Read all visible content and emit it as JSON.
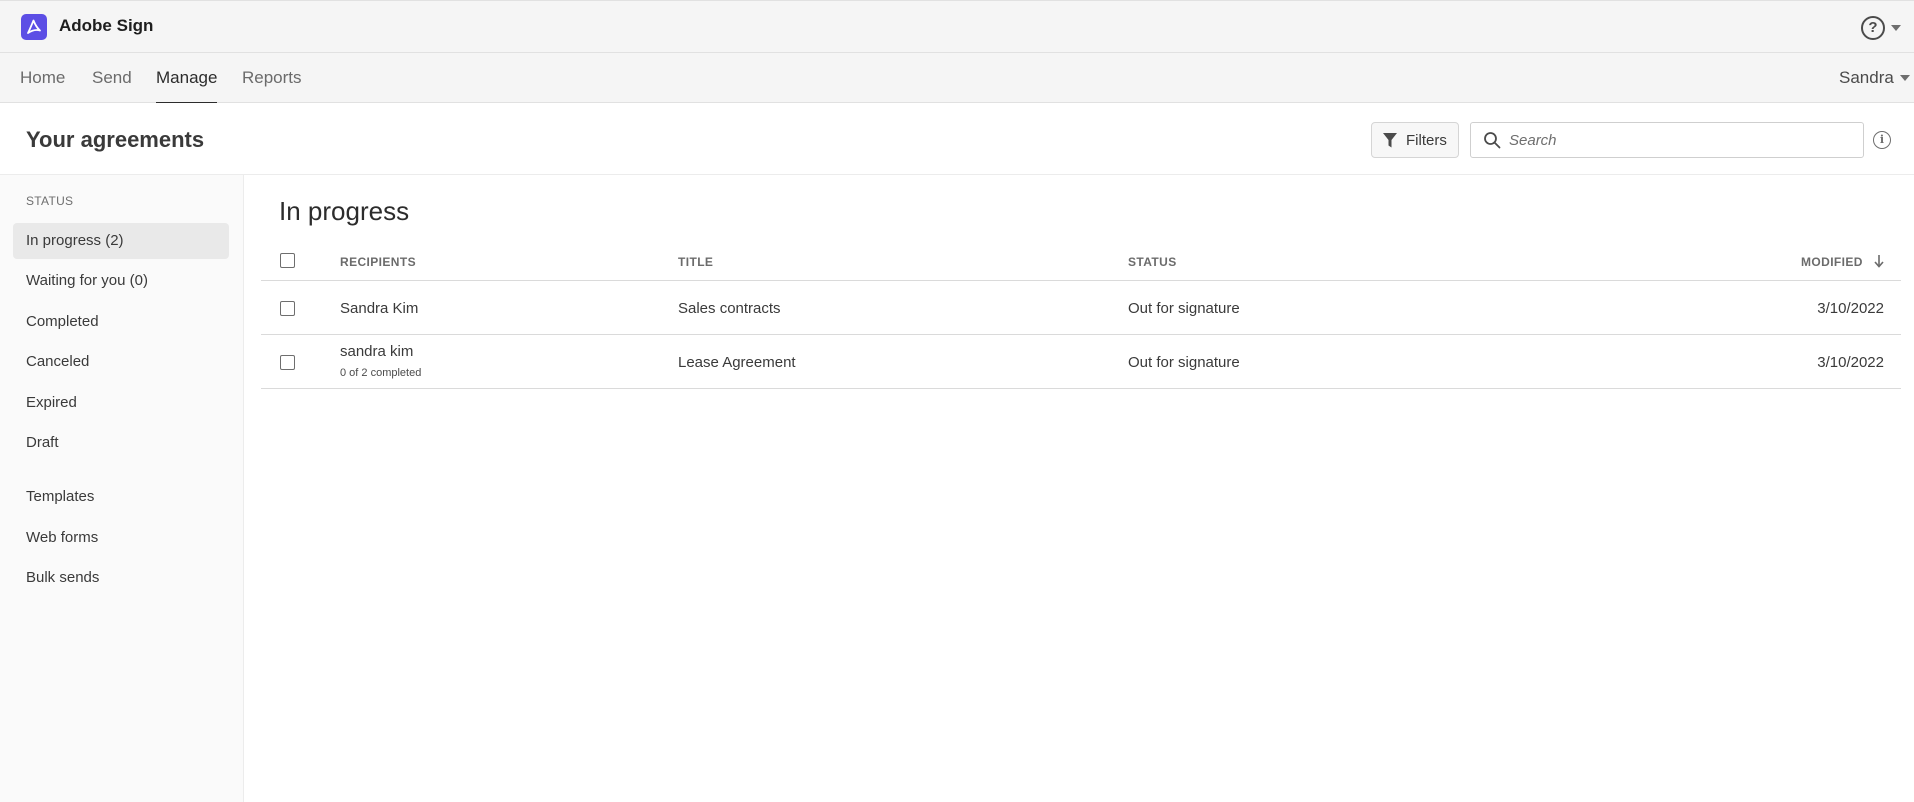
{
  "app": {
    "title": "Adobe Sign",
    "logo_icon": "adobe-acrobat-logo-icon",
    "brand_color": "#5c4ee5"
  },
  "nav": {
    "tabs": [
      {
        "label": "Home"
      },
      {
        "label": "Send"
      },
      {
        "label": "Manage",
        "active": true
      },
      {
        "label": "Reports"
      }
    ],
    "user": "Sandra"
  },
  "page": {
    "title": "Your agreements",
    "filters_label": "Filters",
    "search_placeholder": "Search",
    "search_value": ""
  },
  "sidebar": {
    "heading": "STATUS",
    "status_items": [
      {
        "label": "In progress (2)",
        "selected": true
      },
      {
        "label": "Waiting for you (0)"
      },
      {
        "label": "Completed"
      },
      {
        "label": "Canceled"
      },
      {
        "label": "Expired"
      },
      {
        "label": "Draft"
      }
    ],
    "other_items": [
      {
        "label": "Templates"
      },
      {
        "label": "Web forms"
      },
      {
        "label": "Bulk sends"
      }
    ]
  },
  "main": {
    "section_title": "In progress",
    "columns": {
      "recipients": "RECIPIENTS",
      "title": "TITLE",
      "status": "STATUS",
      "modified": "MODIFIED"
    },
    "rows": [
      {
        "recipient": "Sandra Kim",
        "sub": "",
        "title": "Sales contracts",
        "status": "Out for signature",
        "modified": "3/10/2022"
      },
      {
        "recipient": "sandra kim",
        "sub": "0 of 2 completed",
        "title": "Lease Agreement",
        "status": "Out for signature",
        "modified": "3/10/2022"
      }
    ]
  }
}
